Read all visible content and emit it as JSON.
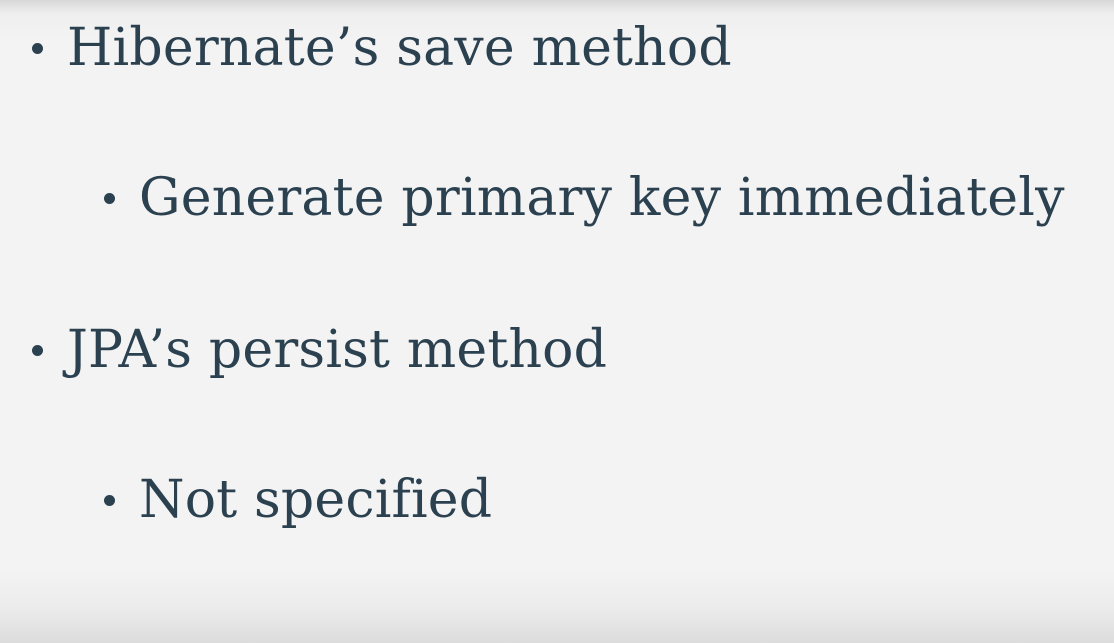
{
  "slide": {
    "items": [
      {
        "level": 1,
        "text": "Hibernate’s save method"
      },
      {
        "level": 2,
        "text": "Generate primary key immediately"
      },
      {
        "level": 1,
        "text": "JPA’s persist method"
      },
      {
        "level": 2,
        "text": "Not specified"
      }
    ]
  },
  "colors": {
    "text": "#2b4150",
    "background": "#f3f3f3"
  }
}
